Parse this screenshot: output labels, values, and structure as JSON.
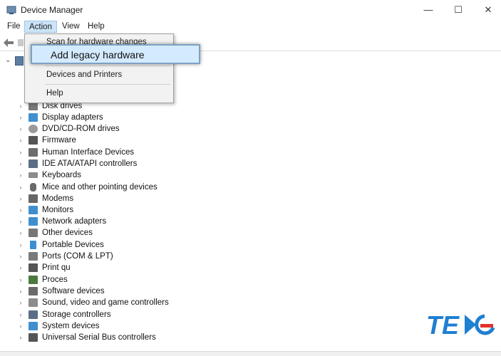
{
  "window": {
    "title": "Device Manager",
    "controls": {
      "minimize": "—",
      "maximize": "☐",
      "close": "✕"
    }
  },
  "menu": [
    {
      "label": "File"
    },
    {
      "label": "Action"
    },
    {
      "label": "View"
    },
    {
      "label": "Help"
    }
  ],
  "action_menu": {
    "items": [
      {
        "label": "Scan for hardware changes"
      },
      {
        "label": "Add legacy hardware",
        "highlighted": true
      },
      {
        "label": "Devices and Printers"
      },
      {
        "label": "Help"
      }
    ]
  },
  "tree": {
    "categories": [
      {
        "label": "Disk drives",
        "icon": "disk-drive-icon",
        "color": "#7a7a7a"
      },
      {
        "label": "Display adapters",
        "icon": "display-adapter-icon",
        "color": "#3f8fcf"
      },
      {
        "label": "DVD/CD-ROM drives",
        "icon": "dvd-drive-icon",
        "color": "#9a9a9a"
      },
      {
        "label": "Firmware",
        "icon": "firmware-icon",
        "color": "#555555"
      },
      {
        "label": "Human Interface Devices",
        "icon": "hid-icon",
        "color": "#6d6d6d"
      },
      {
        "label": "IDE ATA/ATAPI controllers",
        "icon": "ide-controller-icon",
        "color": "#5a6e85"
      },
      {
        "label": "Keyboards",
        "icon": "keyboard-icon",
        "color": "#8c8c8c"
      },
      {
        "label": "Mice and other pointing devices",
        "icon": "mouse-icon",
        "color": "#6a6a6a"
      },
      {
        "label": "Modems",
        "icon": "modem-icon",
        "color": "#666666"
      },
      {
        "label": "Monitors",
        "icon": "monitor-icon",
        "color": "#3f8fcf"
      },
      {
        "label": "Network adapters",
        "icon": "network-adapter-icon",
        "color": "#3f8fcf"
      },
      {
        "label": "Other devices",
        "icon": "other-devices-icon",
        "color": "#777777"
      },
      {
        "label": "Portable Devices",
        "icon": "portable-device-icon",
        "color": "#3f8fcf"
      },
      {
        "label": "Ports (COM & LPT)",
        "icon": "port-icon",
        "color": "#7a7a7a"
      },
      {
        "label": "Print qu",
        "icon": "printer-icon",
        "color": "#555555"
      },
      {
        "label": "Proces",
        "icon": "processor-icon",
        "color": "#4b7a3c"
      },
      {
        "label": "Software devices",
        "icon": "software-device-icon",
        "color": "#6a6a6a"
      },
      {
        "label": "Sound, video and game controllers",
        "icon": "sound-icon",
        "color": "#8c8c8c"
      },
      {
        "label": "Storage controllers",
        "icon": "storage-controller-icon",
        "color": "#5a6e85"
      },
      {
        "label": "System devices",
        "icon": "system-devices-icon",
        "color": "#3f8fcf"
      },
      {
        "label": "Universal Serial Bus controllers",
        "icon": "usb-controller-icon",
        "color": "#555555"
      }
    ]
  },
  "colors": {
    "menu_active_bg": "#cce4f7",
    "highlight_bg": "#d4eaff",
    "logo_blue": "#1f7fd1",
    "logo_red": "#e0322b"
  }
}
